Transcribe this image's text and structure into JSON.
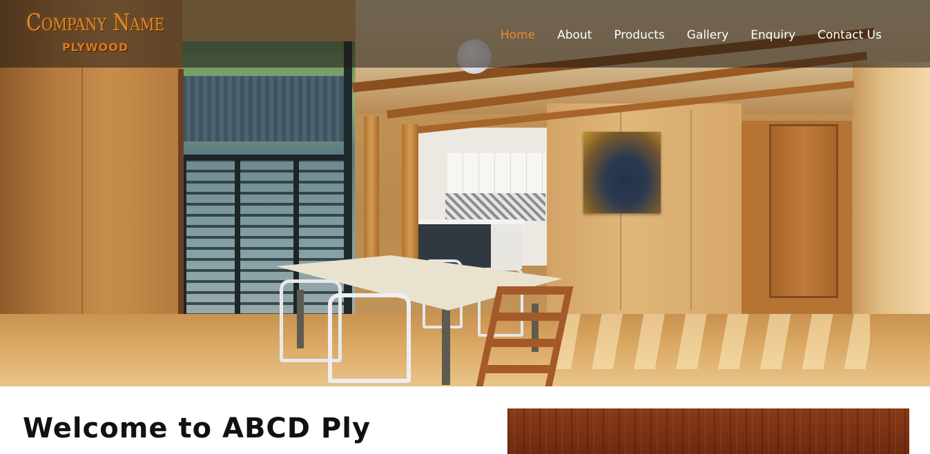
{
  "brand": {
    "name": "Company Name",
    "tagline": "PLYWOOD"
  },
  "nav": {
    "items": [
      {
        "label": "Home",
        "active": true
      },
      {
        "label": "About",
        "active": false
      },
      {
        "label": "Products",
        "active": false
      },
      {
        "label": "Gallery",
        "active": false
      },
      {
        "label": "Enquiry",
        "active": false
      },
      {
        "label": "Contact Us",
        "active": false
      }
    ]
  },
  "main": {
    "welcome_heading": "Welcome to ABCD Ply"
  },
  "colors": {
    "nav_active": "#ee8a2c",
    "nav_text": "#ffffff",
    "logo": "#e58a24",
    "heading": "#111111"
  }
}
